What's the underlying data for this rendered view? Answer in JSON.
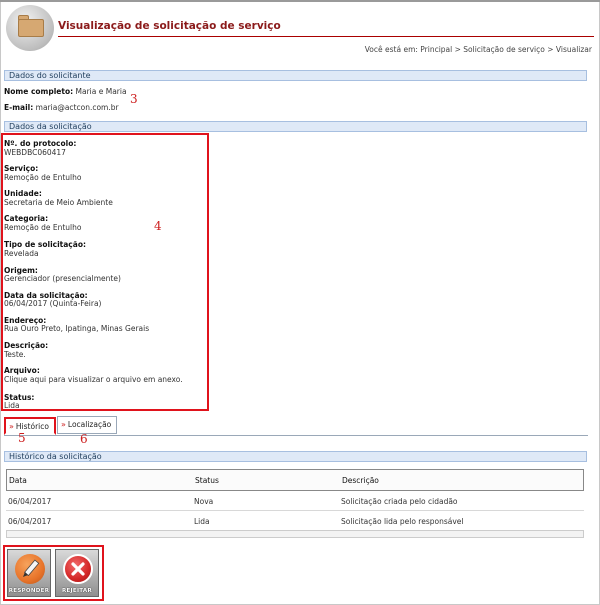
{
  "header": {
    "title": "Visualização de solicitação de serviço",
    "breadcrumb": "Você está em: Principal > Solicitação de serviço > Visualizar"
  },
  "requester": {
    "section_title": "Dados do solicitante",
    "name_label": "Nome completo:",
    "name_value": "Maria e Maria",
    "email_label": "E-mail:",
    "email_value": "maria@actcon.com.br"
  },
  "request": {
    "section_title": "Dados da solicitação",
    "fields": [
      {
        "label": "Nº. do protocolo:",
        "value": "WEBDBC060417"
      },
      {
        "label": "Serviço:",
        "value": "Remoção de Entulho"
      },
      {
        "label": "Unidade:",
        "value": "Secretaria de Meio Ambiente"
      },
      {
        "label": "Categoria:",
        "value": "Remoção de Entulho"
      },
      {
        "label": "Tipo de solicitação:",
        "value": "Revelada"
      },
      {
        "label": "Origem:",
        "value": "Gerenciador (presencialmente)"
      },
      {
        "label": "Data da solicitação:",
        "value": "06/04/2017 (Quinta-Feira)"
      },
      {
        "label": "Endereço:",
        "value": "Rua Ouro Preto, Ipatinga, Minas Gerais"
      },
      {
        "label": "Descrição:",
        "value": "Teste."
      },
      {
        "label": "Arquivo:",
        "value": "Clique aqui para visualizar o arquivo em anexo."
      },
      {
        "label": "Status:",
        "value": "Lida"
      }
    ]
  },
  "tabs": [
    {
      "label": "Histórico",
      "active": true
    },
    {
      "label": "Localização",
      "active": false
    }
  ],
  "history": {
    "section_title": "Histórico da solicitação",
    "columns": [
      "Data",
      "Status",
      "Descrição"
    ],
    "rows": [
      [
        "06/04/2017",
        "Nova",
        "Solicitação criada pelo cidadão"
      ],
      [
        "06/04/2017",
        "Lida",
        "Solicitação lida pelo responsável"
      ]
    ]
  },
  "actions": {
    "respond_label": "RESPONDER",
    "reject_label": "REJEITAR"
  },
  "annotations": [
    "3",
    "4",
    "5",
    "6"
  ],
  "colors": {
    "title": "#8b1a1a",
    "section_bar": "#dfe9f7",
    "annotation_red": "#e0131c",
    "respond_orange": "#e8742a",
    "reject_red": "#d42727"
  },
  "icons": {
    "logo": "folder-icon",
    "respond": "pencil-icon",
    "reject": "close-icon",
    "tab": "chevron-down-icon"
  }
}
